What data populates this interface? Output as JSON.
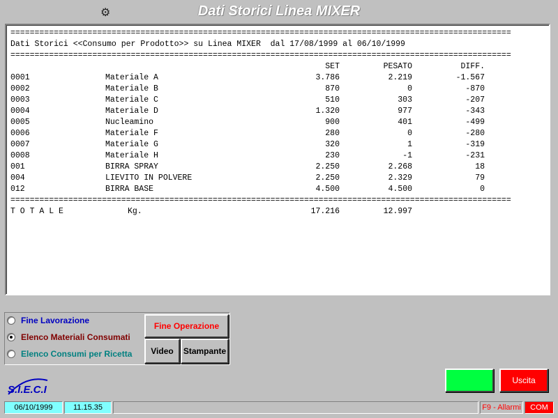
{
  "window": {
    "title": "Dati Storici Linea MIXER"
  },
  "report": {
    "separator": "========================================================================================================",
    "heading": "Dati Storici <<Consumo per Prodotto>> su Linea MIXER  dal 17/08/1999 al 06/10/1999",
    "columns": {
      "set": "SET",
      "pesato": "PESATO",
      "diff": "DIFF."
    },
    "rows": [
      {
        "code": "0001",
        "name": "Materiale A",
        "set": "3.786",
        "pesato": "2.219",
        "diff": "-1.567"
      },
      {
        "code": "0002",
        "name": "Materiale B",
        "set": "870",
        "pesato": "0",
        "diff": "-870"
      },
      {
        "code": "0003",
        "name": "Materiale C",
        "set": "510",
        "pesato": "303",
        "diff": "-207"
      },
      {
        "code": "0004",
        "name": "Materiale D",
        "set": "1.320",
        "pesato": "977",
        "diff": "-343"
      },
      {
        "code": "0005",
        "name": "Nucleamino",
        "set": "900",
        "pesato": "401",
        "diff": "-499"
      },
      {
        "code": "0006",
        "name": "Materiale F",
        "set": "280",
        "pesato": "0",
        "diff": "-280"
      },
      {
        "code": "0007",
        "name": "Materiale G",
        "set": "320",
        "pesato": "1",
        "diff": "-319"
      },
      {
        "code": "0008",
        "name": "Materiale H",
        "set": "230",
        "pesato": "-1",
        "diff": "-231"
      },
      {
        "code": "001",
        "name": "BIRRA SPRAY",
        "set": "2.250",
        "pesato": "2.268",
        "diff": "18"
      },
      {
        "code": "004",
        "name": "LIEVITO IN POLVERE",
        "set": "2.250",
        "pesato": "2.329",
        "diff": "79"
      },
      {
        "code": "012",
        "name": "BIRRA BASE",
        "set": "4.500",
        "pesato": "4.500",
        "diff": "0"
      }
    ],
    "total": {
      "label": "T O T A L E",
      "unit": "Kg.",
      "set": "17.216",
      "pesato": "12.997"
    }
  },
  "options": {
    "fine_lavorazione": {
      "label": "Fine Lavorazione",
      "color": "#0000c0"
    },
    "elenco_materiali": {
      "label": "Elenco Materiali Consumati",
      "color": "#800000",
      "selected": true
    },
    "elenco_consumi": {
      "label": "Elenco Consumi per Ricetta",
      "color": "#008080"
    }
  },
  "buttons": {
    "fine_operazione": "Fine Operazione",
    "video": "Video",
    "stampante": "Stampante",
    "uscita": "Uscita"
  },
  "logo": {
    "text": "S.I.E.C.I"
  },
  "status": {
    "date": "06/10/1999",
    "time": "11.15.35",
    "alarms": "F9 - Allarmi",
    "com": "COM"
  },
  "colors": {
    "green_button": "#00ff40",
    "red_button": "#ff0000",
    "status_cyan": "#80ffff",
    "fine_operazione_text": "#ff0000"
  }
}
